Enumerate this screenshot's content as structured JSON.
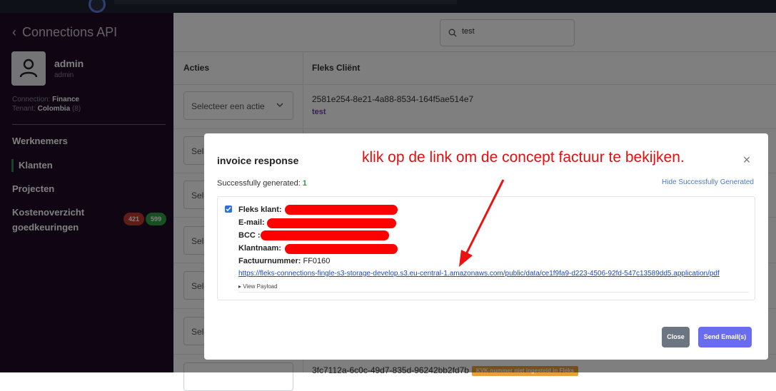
{
  "sidebar": {
    "back_label": "Connections API",
    "user_name": "admin",
    "user_role": "admin",
    "connection_label": "Connection:",
    "connection_value": "Finance",
    "tenant_label": "Tenant:",
    "tenant_value": "Colombia",
    "tenant_count": "(8)",
    "nav": [
      "Werknemers",
      "Klanten",
      "Projecten"
    ],
    "nav_cost_line1": "Kostenoverzicht",
    "nav_cost_line2": "goedkeuringen",
    "badge_red": "421",
    "badge_green": "599"
  },
  "main": {
    "search_value": "test",
    "col_actions": "Acties",
    "col_client": "Fleks Cliënt",
    "select_placeholder": "Selecteer een actie",
    "select_partial": "Sele",
    "row1_id": "2581e254-8e21-4a88-8534-164f5ae514e7",
    "row1_name": "test",
    "row_last_id": "3fc7112a-6c0c-49d7-835d-96242bb2fd7b",
    "kvk_badge": "KVK-nummer niet ingesteld in Fleks"
  },
  "modal": {
    "title": "invoice response",
    "annotation": "klik op de link om de concept factuur te bekijken.",
    "close_symbol": "×",
    "success_label": "Successfully generated:",
    "success_count": "1",
    "hide_link": "Hide Successfully Generated",
    "field_klant": "Fleks klant:",
    "field_email": "E-mail:",
    "field_bcc": "BCC :",
    "field_klantnaam": "Klantnaam:",
    "field_factuur": "Factuurnummer:",
    "factuur_value": "FF0160",
    "pdf_url": "https://fleks-connections-fingle-s3-storage-develop.s3.eu-central-1.amazonaws.com/public/data/ce1f9fa9-d223-4506-92fd-547c13589dd5.application/pdf",
    "view_payload": "▸ View Payload",
    "btn_close": "Close",
    "btn_send": "Send Email(s)"
  },
  "colors": {
    "sidebar_bg": "#1f0a26",
    "annotation_red": "#e01010",
    "send_button": "#6a6cf0",
    "close_button": "#6b7682",
    "badge_red": "#c0392b",
    "badge_green": "#2e9c44"
  }
}
